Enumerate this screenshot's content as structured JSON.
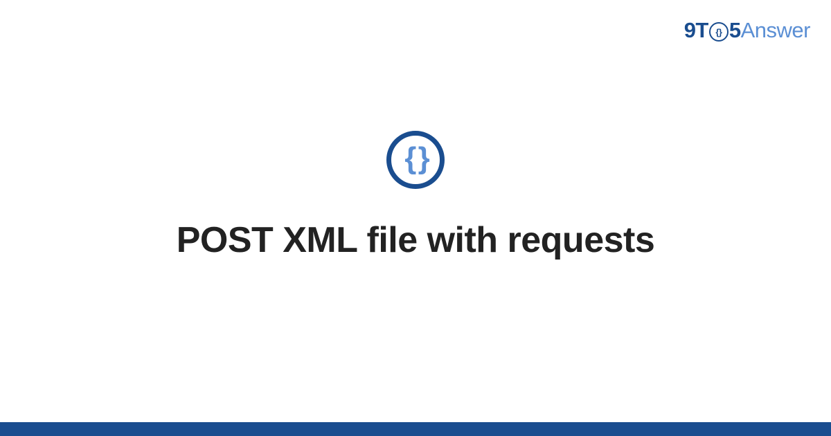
{
  "logo": {
    "part1": "9T",
    "clock_inner": "{}",
    "part2": "5",
    "part3": "Answer"
  },
  "icon": {
    "braces": "{ }"
  },
  "title": "POST XML file with requests"
}
